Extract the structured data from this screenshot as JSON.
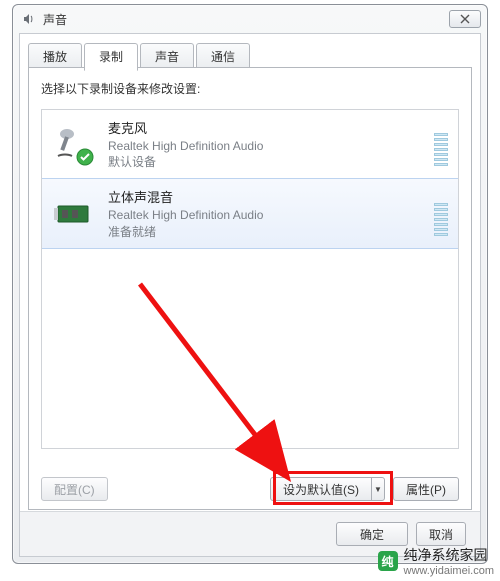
{
  "window": {
    "title": "声音"
  },
  "tabs": {
    "items": [
      {
        "label": "播放"
      },
      {
        "label": "录制"
      },
      {
        "label": "声音"
      },
      {
        "label": "通信"
      }
    ],
    "active_index": 1
  },
  "page": {
    "instruction": "选择以下录制设备来修改设置:"
  },
  "devices": [
    {
      "name": "麦克风",
      "driver": "Realtek High Definition Audio",
      "status": "默认设备",
      "icon": "microphone",
      "default": true
    },
    {
      "name": "立体声混音",
      "driver": "Realtek High Definition Audio",
      "status": "准备就绪",
      "icon": "soundcard",
      "selected": true
    }
  ],
  "buttons": {
    "configure": "配置(C)",
    "set_default": "设为默认值(S)",
    "properties": "属性(P)",
    "ok": "确定",
    "cancel": "取消"
  },
  "watermark": {
    "brand": "纯净系统家园",
    "url": "www.yidaimei.com"
  }
}
